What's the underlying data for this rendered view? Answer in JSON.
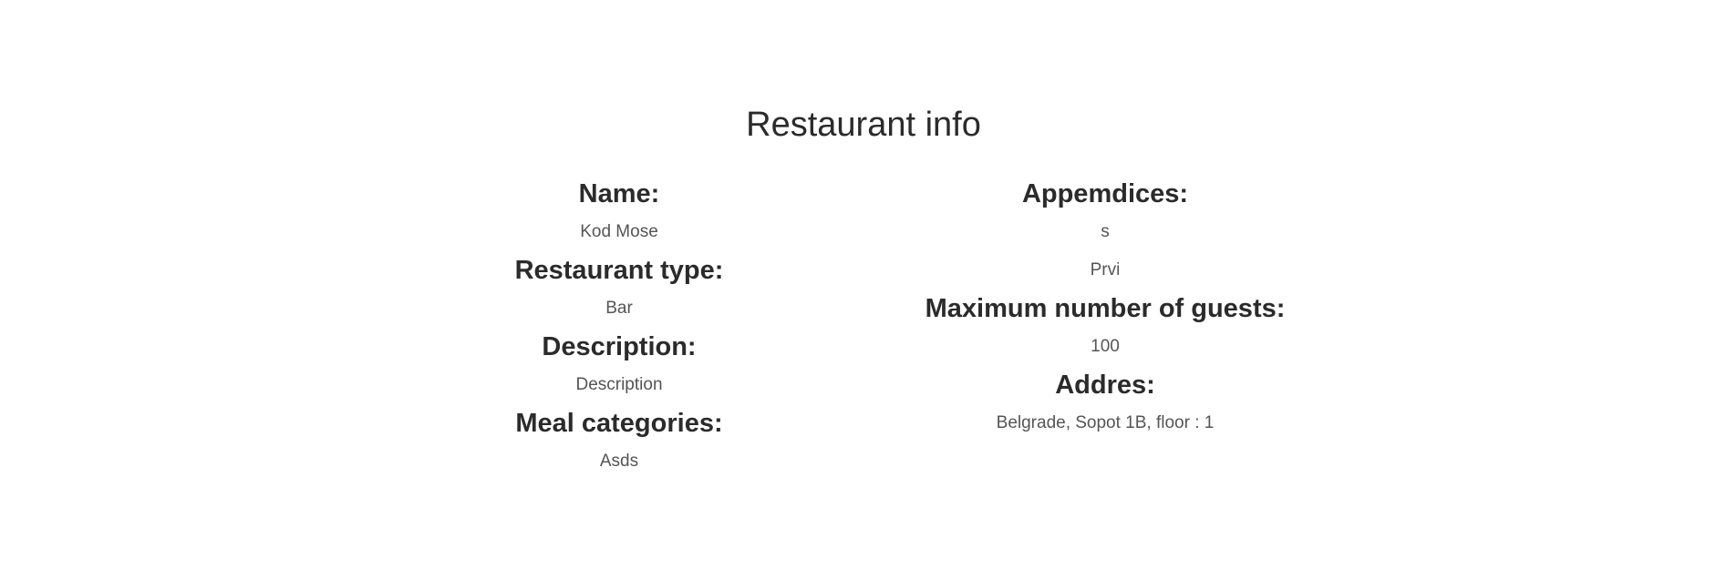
{
  "page": {
    "title": "Restaurant info"
  },
  "left_column": {
    "name_label": "Name:",
    "name_value": "Kod Mose",
    "type_label": "Restaurant type:",
    "type_value": "Bar",
    "description_label": "Description:",
    "description_value": "Description",
    "meal_categories_label": "Meal categories:",
    "meal_categories_value": "Asds"
  },
  "right_column": {
    "appendices_label": "Appemdices:",
    "appendices_values": [
      "s",
      "Prvi"
    ],
    "max_guests_label": "Maximum number of guests:",
    "max_guests_value": "100",
    "address_label": "Addres:",
    "address_value": "Belgrade, Sopot 1B, floor : 1"
  }
}
